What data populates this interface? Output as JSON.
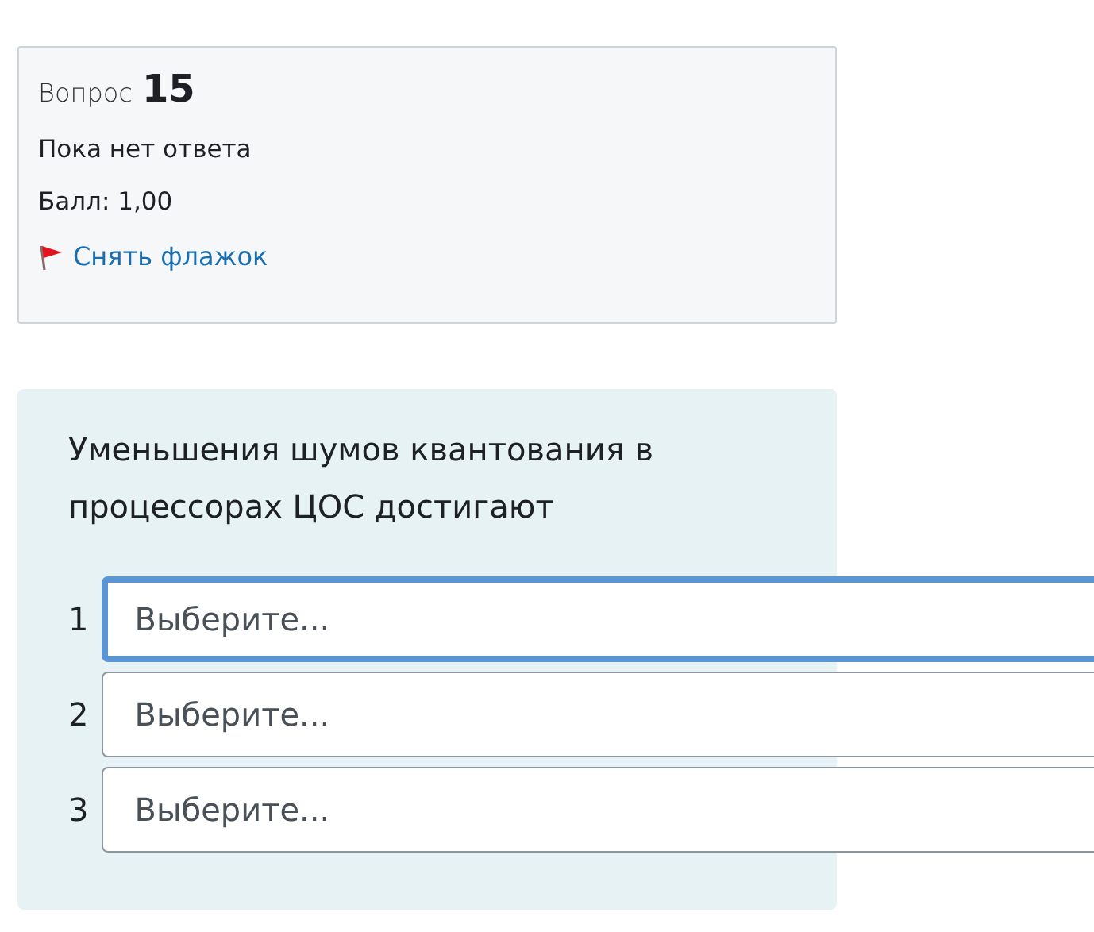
{
  "info": {
    "label": "Вопрос",
    "number": "15",
    "status": "Пока нет ответа",
    "grade": "Балл: 1,00",
    "flag_link": "Снять флажок"
  },
  "question": {
    "text": "Уменьшения шумов квантования в процессорах ЦОС достигают",
    "answers": [
      {
        "index": "1",
        "value": "Выберите...",
        "focused": true
      },
      {
        "index": "2",
        "value": "Выберите...",
        "focused": false
      },
      {
        "index": "3",
        "value": "Выберите...",
        "focused": false
      }
    ]
  }
}
